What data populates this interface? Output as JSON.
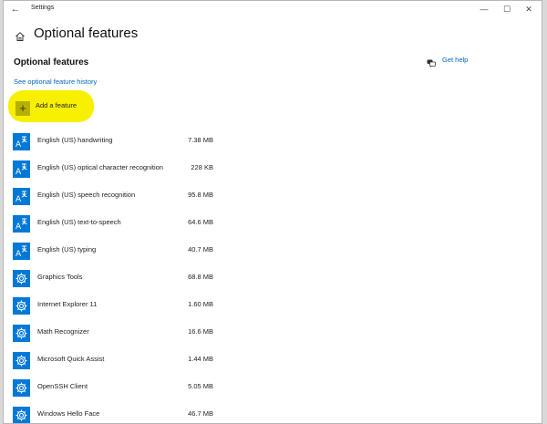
{
  "window": {
    "title": "Settings",
    "back_glyph": "←",
    "minimize_glyph": "—",
    "maximize_glyph": "☐",
    "close_glyph": "✕"
  },
  "header": {
    "title": "Optional features"
  },
  "section": {
    "title": "Optional features",
    "history_link": "See optional feature history"
  },
  "help": {
    "label": "Get help",
    "icon": "chat-help-icon"
  },
  "add_feature": {
    "label": "Add a feature",
    "plus_glyph": "+",
    "highlight_color": "#f7f000"
  },
  "accent_color": "#0078d7",
  "features": [
    {
      "name": "English (US) handwriting",
      "size": "7.38 MB",
      "icon": "language-icon"
    },
    {
      "name": "English (US) optical character recognition",
      "size": "228 KB",
      "icon": "language-icon"
    },
    {
      "name": "English (US) speech recognition",
      "size": "95.8 MB",
      "icon": "language-icon"
    },
    {
      "name": "English (US) text-to-speech",
      "size": "64.6 MB",
      "icon": "language-icon"
    },
    {
      "name": "English (US) typing",
      "size": "40.7 MB",
      "icon": "language-icon"
    },
    {
      "name": "Graphics Tools",
      "size": "68.8 MB",
      "icon": "gear-icon"
    },
    {
      "name": "Internet Explorer 11",
      "size": "1.60 MB",
      "icon": "gear-icon"
    },
    {
      "name": "Math Recognizer",
      "size": "16.6 MB",
      "icon": "gear-icon"
    },
    {
      "name": "Microsoft Quick Assist",
      "size": "1.44 MB",
      "icon": "gear-icon"
    },
    {
      "name": "OpenSSH Client",
      "size": "5.05 MB",
      "icon": "gear-icon"
    },
    {
      "name": "Windows Hello Face",
      "size": "46.7 MB",
      "icon": "gear-icon"
    }
  ]
}
